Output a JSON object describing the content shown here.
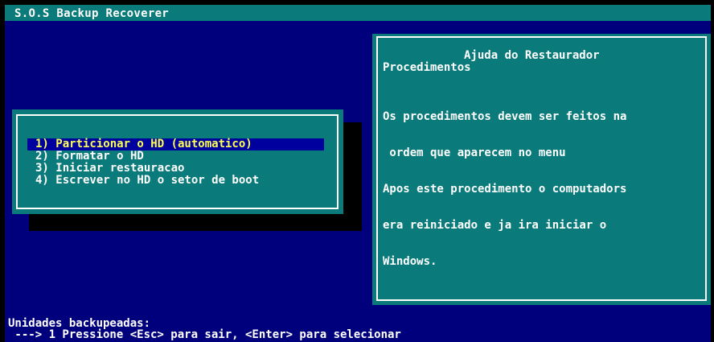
{
  "app": {
    "title": "S.O.S Backup Recoverer"
  },
  "menu": {
    "items": [
      {
        "label": "1) Particionar o HD (automatico)",
        "selected": true
      },
      {
        "label": "2) Formatar o HD",
        "selected": false
      },
      {
        "label": "3) Iniciar restauracao",
        "selected": false
      },
      {
        "label": "4) Escrever no HD o setor de boot",
        "selected": false
      }
    ]
  },
  "help": {
    "title": "Ajuda do Restaurador",
    "subtitle": "Procedimentos",
    "lines": [
      "Os procedimentos devem ser feitos na",
      " ordem que aparecem no menu",
      "Apos este procedimento o computadors",
      "era reiniciado e ja ira iniciar o",
      "Windows."
    ]
  },
  "status": {
    "line1": "Unidades backupeadas:",
    "line2": " ---> 1 Pressione <Esc> para sair, <Enter> para selecionar"
  },
  "colors": {
    "desktop_blue": "#00007d",
    "panel_teal": "#0a7a7a",
    "highlight_bar": "#00009e",
    "highlight_text": "#ffff55",
    "text": "#ffffff"
  }
}
